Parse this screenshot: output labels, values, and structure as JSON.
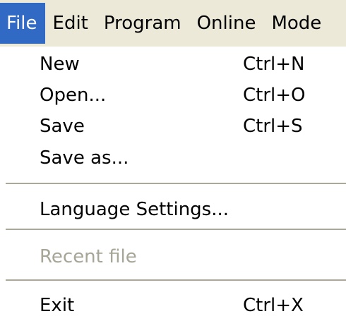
{
  "menubar": {
    "items": [
      {
        "label": "File"
      },
      {
        "label": "Edit"
      },
      {
        "label": "Program"
      },
      {
        "label": "Online"
      },
      {
        "label": "Mode"
      }
    ]
  },
  "file_menu": {
    "items": [
      {
        "label": "New",
        "shortcut": "Ctrl+N"
      },
      {
        "label": "Open...",
        "shortcut": "Ctrl+O"
      },
      {
        "label": "Save",
        "shortcut": "Ctrl+S"
      },
      {
        "label": "Save as..."
      },
      {
        "label": "Language Settings..."
      },
      {
        "label": "Recent file",
        "disabled": true
      },
      {
        "label": "Exit",
        "shortcut": "Ctrl+X"
      }
    ]
  },
  "colors": {
    "menubar_background": "#ece9d8",
    "highlight": "#316ac5",
    "disabled_text": "#a7a596",
    "separator": "#aca899"
  }
}
